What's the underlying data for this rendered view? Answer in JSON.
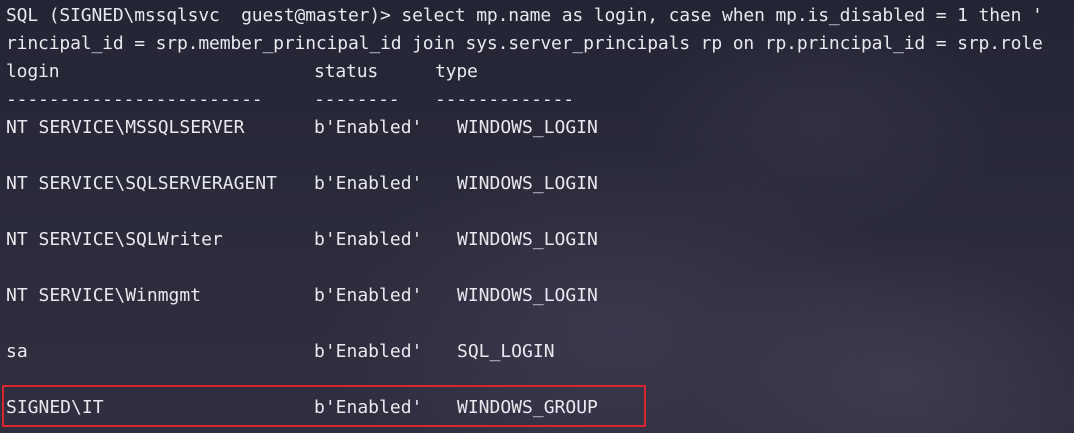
{
  "terminal": {
    "command_line_1": "SQL (SIGNED\\mssqlsvc  guest@master)> select mp.name as login, case when mp.is_disabled = 1 then '",
    "command_line_2": "rincipal_id = srp.member_principal_id join sys.server_principals rp on rp.principal_id = srp.role",
    "headers": {
      "login": "login",
      "status": "status",
      "type": "type"
    },
    "separators": {
      "login": "------------------------",
      "status": "--------",
      "type": "-------------"
    },
    "rows": [
      {
        "login": "NT SERVICE\\MSSQLSERVER",
        "status": "b'Enabled'",
        "type": "WINDOWS_LOGIN"
      },
      {
        "login": "NT SERVICE\\SQLSERVERAGENT",
        "status": "b'Enabled'",
        "type": "WINDOWS_LOGIN"
      },
      {
        "login": "NT SERVICE\\SQLWriter",
        "status": "b'Enabled'",
        "type": "WINDOWS_LOGIN"
      },
      {
        "login": "NT SERVICE\\Winmgmt",
        "status": "b'Enabled'",
        "type": "WINDOWS_LOGIN"
      },
      {
        "login": "sa",
        "status": "b'Enabled'",
        "type": "SQL_LOGIN"
      },
      {
        "login": "SIGNED\\IT",
        "status": "b'Enabled'",
        "type": "WINDOWS_GROUP"
      }
    ],
    "highlight_color": "#d9252f",
    "text_color": "#e8e8ee",
    "background_color": "#2a2b3a"
  }
}
